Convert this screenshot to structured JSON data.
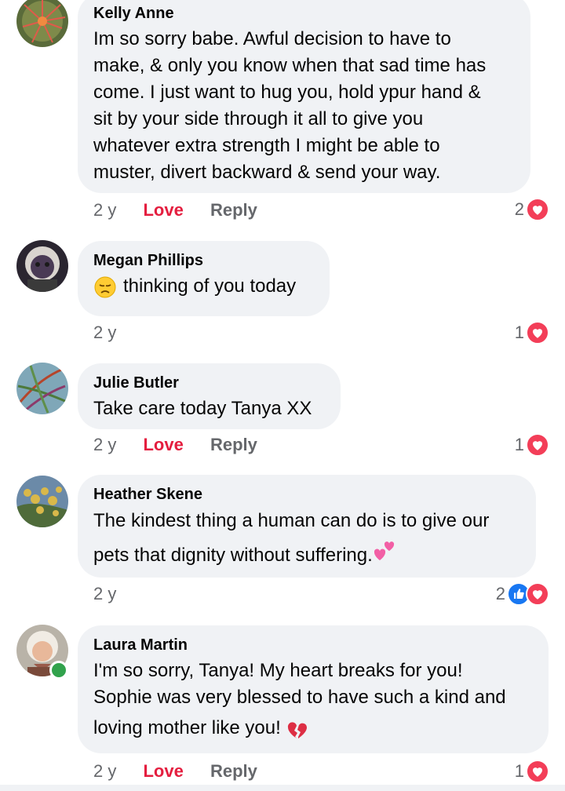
{
  "comments": [
    {
      "author": "Kelly Anne",
      "lines": [
        "Im so sorry babe. Awful decision to have to",
        "make, & only you know when that sad time has",
        "come. I just want to hug you, hold ypur hand &",
        "sit by your side through it all to give you",
        "whatever extra strength I might be able to",
        "muster, divert backward & send your way."
      ],
      "time": "2 y",
      "love_label": "Love",
      "reply_label": "Reply",
      "reaction_count": "2",
      "reactions": [
        "heart-icon"
      ]
    },
    {
      "author": "Megan Phillips",
      "lines": [
        "thinking of you today"
      ],
      "leading_emoji": "disappointed-face-emoji",
      "time": "2 y",
      "reaction_count": "1",
      "reactions": [
        "heart-icon"
      ]
    },
    {
      "author": "Julie Butler",
      "lines": [
        "Take care today Tanya XX"
      ],
      "time": "2 y",
      "love_label": "Love",
      "reply_label": "Reply",
      "reaction_count": "1",
      "reactions": [
        "heart-icon"
      ]
    },
    {
      "author": "Heather Skene",
      "lines": [
        "The kindest thing a human can do is to give our",
        "pets that dignity without suffering."
      ],
      "trailing_emoji": "two-hearts-emoji",
      "time": "2 y",
      "reaction_count": "2",
      "reactions": [
        "like-icon",
        "heart-icon"
      ]
    },
    {
      "author": "Laura Martin",
      "lines": [
        "I'm so sorry, Tanya! My heart breaks for you!",
        "Sophie was very blessed to have such a kind and",
        "loving mother like you!"
      ],
      "trailing_emoji": "broken-heart-emoji",
      "online": true,
      "time": "2 y",
      "love_label": "Love",
      "reply_label": "Reply",
      "reaction_count": "1",
      "reactions": [
        "heart-icon"
      ]
    }
  ],
  "colors": {
    "bubble": "#f0f2f5",
    "love": "#e41e3f",
    "meta": "#65676b",
    "heart_reaction": "#f33e58",
    "like_reaction": "#1877f2",
    "online": "#31a24c"
  }
}
